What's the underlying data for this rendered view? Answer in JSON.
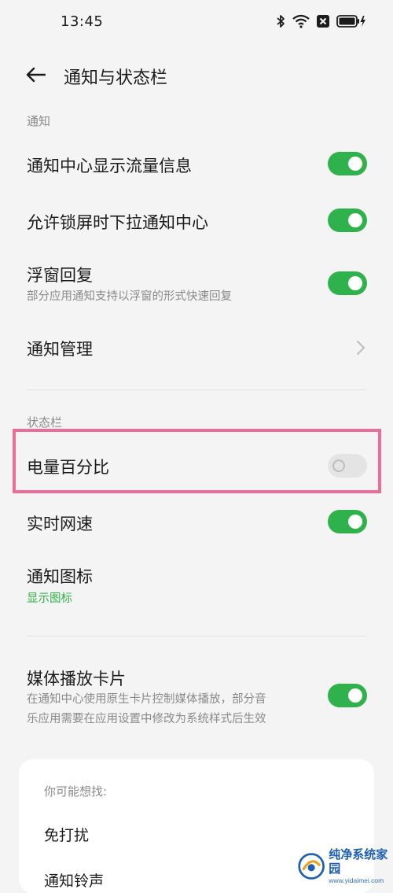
{
  "status_bar": {
    "time": "13:45",
    "icons": [
      "bluetooth-icon",
      "wifi-icon",
      "no-sim-icon",
      "battery-charging-icon"
    ]
  },
  "header": {
    "title": "通知与状态栏"
  },
  "sections": {
    "notifications": {
      "label": "通知",
      "items": [
        {
          "title": "通知中心显示流量信息",
          "toggle": true
        },
        {
          "title": "允许锁屏时下拉通知中心",
          "toggle": true
        },
        {
          "title": "浮窗回复",
          "subtitle": "部分应用通知支持以浮窗的形式快速回复",
          "toggle": true
        },
        {
          "title": "通知管理"
        }
      ]
    },
    "status_bar": {
      "label": "状态栏",
      "items": [
        {
          "title": "电量百分比",
          "toggle": false
        },
        {
          "title": "实时网速",
          "toggle": true
        },
        {
          "title": "通知图标",
          "subtitle": "显示图标"
        }
      ]
    },
    "media": {
      "items": [
        {
          "title": "媒体播放卡片",
          "subtitle_line1": "在通知中心使用原生卡片控制媒体播放，部分音",
          "subtitle_line2": "乐应用需要在应用设置中修改为系统样式后生效",
          "toggle": true
        }
      ]
    }
  },
  "suggestions": {
    "title": "你可能想找:",
    "items": [
      "免打扰",
      "通知铃声"
    ]
  },
  "watermark": {
    "name": "纯净系统家园",
    "url": "www.yidaimei.com"
  },
  "colors": {
    "accent_green": "#2fb14b",
    "highlight_pink": "#ee6c98",
    "background": "#f4f4f4"
  }
}
